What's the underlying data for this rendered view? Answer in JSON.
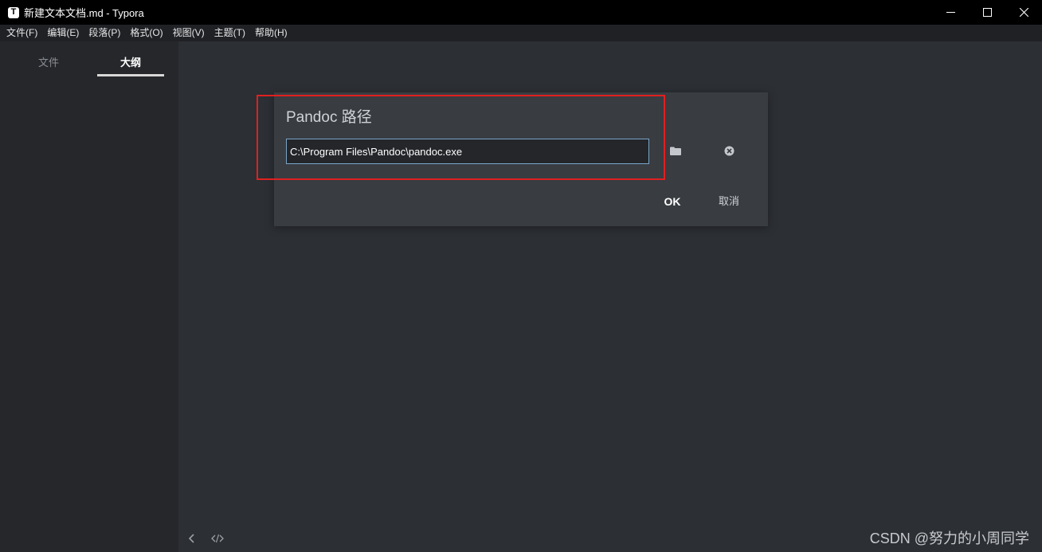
{
  "window": {
    "title": "新建文本文档.md - Typora",
    "app_icon_letter": "T"
  },
  "menu": {
    "items": [
      "文件(F)",
      "编辑(E)",
      "段落(P)",
      "格式(O)",
      "视图(V)",
      "主题(T)",
      "帮助(H)"
    ]
  },
  "sidebar": {
    "tabs": [
      {
        "label": "文件",
        "active": false
      },
      {
        "label": "大纲",
        "active": true
      }
    ]
  },
  "dialog": {
    "title": "Pandoc 路径",
    "path_value": "C:\\Program Files\\Pandoc\\pandoc.exe",
    "ok_label": "OK",
    "cancel_label": "取消",
    "browse_icon": "folder-icon",
    "clear_icon": "close-circle-icon"
  },
  "footer": {
    "icons": [
      "chevron-left-icon",
      "code-icon"
    ]
  },
  "watermark": "CSDN @努力的小周同学",
  "colors": {
    "highlight": "#e02020",
    "input_border": "#7aa6c8",
    "dialog_bg": "#393c41"
  }
}
